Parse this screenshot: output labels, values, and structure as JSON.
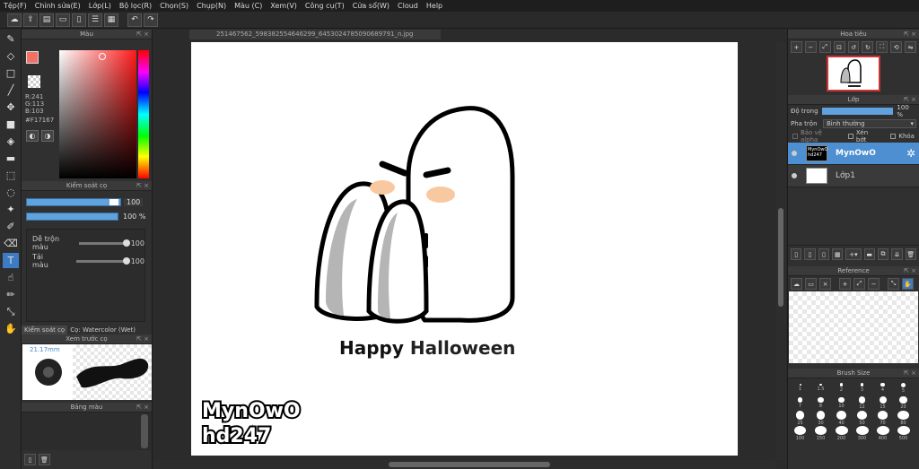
{
  "menu": [
    "Tệp(F)",
    "Chỉnh sửa(E)",
    "Lớp(L)",
    "Bộ lọc(R)",
    "Chọn(S)",
    "Chụp(N)",
    "Màu (C)",
    "Xem(V)",
    "Công cụ(T)",
    "Cửa sổ(W)",
    "Cloud",
    "Help"
  ],
  "color_panel": {
    "title": "Màu",
    "r": "R:241",
    "g": "G:113",
    "b": "B:103",
    "hex": "#F17167",
    "fg": "#F17167"
  },
  "brush_control": {
    "title": "Kiểm soát cọ",
    "size": "100",
    "opacity": "100 %",
    "blend_label": "Dễ trộn màu",
    "blend_value": "100",
    "load_label": "Tải màu",
    "load_value": "100",
    "tab1": "Kiểm soát cọ",
    "tab2": "Cọ: Watercolor (Wet)"
  },
  "preview": {
    "title": "Xem trước cọ",
    "size": "21.17mm"
  },
  "palette": {
    "title": "Bảng màu"
  },
  "document": {
    "filename": "251467562_598382554646299_6453024785090689791_n.jpg"
  },
  "artwork": {
    "text": "Happy Halloween",
    "watermark1": "MynOwO",
    "watermark2": "hd247"
  },
  "navigator": {
    "title": "Hoa tiêu"
  },
  "layers": {
    "title": "Lớp",
    "opacity_label": "Độ trong",
    "opacity_value": "100 %",
    "blend_label": "Pha trộn",
    "blend_value": "Bình thường",
    "protect_alpha": "Bảo vệ alpha",
    "clipping": "Xén bớt",
    "lock": "Khóa",
    "items": [
      {
        "name": "MynOwO",
        "thumb": "MynOwO hd247"
      },
      {
        "name": "Lớp1"
      }
    ]
  },
  "reference": {
    "title": "Reference"
  },
  "brush_size": {
    "title": "Brush Size",
    "sizes": [
      "1",
      "1.5",
      "2",
      "3",
      "4",
      "5",
      "7",
      "8",
      "10",
      "12",
      "15",
      "20",
      "25",
      "30",
      "40",
      "50",
      "70",
      "80",
      "100",
      "150",
      "200",
      "300",
      "400",
      "500"
    ]
  }
}
